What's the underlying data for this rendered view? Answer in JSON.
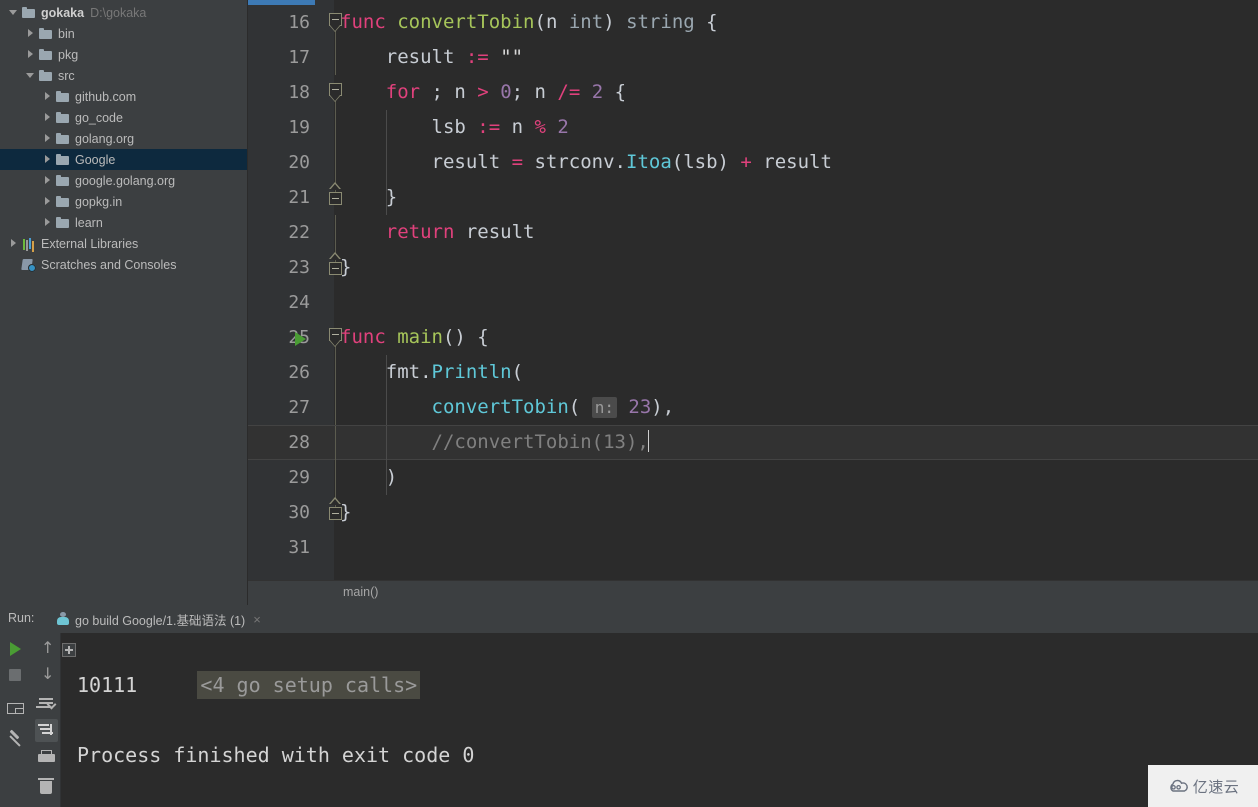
{
  "project_tree": {
    "items": [
      {
        "label": "gokaka",
        "sub": "D:\\gokaka",
        "icon": "folder-icon",
        "arrow": "open",
        "depth": 0,
        "bold": true,
        "selected": false
      },
      {
        "label": "bin",
        "sub": "",
        "icon": "folder-icon",
        "arrow": "closed",
        "depth": 1,
        "bold": false,
        "selected": false
      },
      {
        "label": "pkg",
        "sub": "",
        "icon": "folder-icon",
        "arrow": "closed",
        "depth": 1,
        "bold": false,
        "selected": false
      },
      {
        "label": "src",
        "sub": "",
        "icon": "folder-icon",
        "arrow": "open",
        "depth": 1,
        "bold": false,
        "selected": false
      },
      {
        "label": "github.com",
        "sub": "",
        "icon": "folder-icon",
        "arrow": "closed",
        "depth": 2,
        "bold": false,
        "selected": false
      },
      {
        "label": "go_code",
        "sub": "",
        "icon": "folder-icon",
        "arrow": "closed",
        "depth": 2,
        "bold": false,
        "selected": false
      },
      {
        "label": "golang.org",
        "sub": "",
        "icon": "folder-icon",
        "arrow": "closed",
        "depth": 2,
        "bold": false,
        "selected": false
      },
      {
        "label": "Google",
        "sub": "",
        "icon": "folder-icon",
        "arrow": "closed",
        "depth": 2,
        "bold": false,
        "selected": true
      },
      {
        "label": "google.golang.org",
        "sub": "",
        "icon": "folder-icon",
        "arrow": "closed",
        "depth": 2,
        "bold": false,
        "selected": false
      },
      {
        "label": "gopkg.in",
        "sub": "",
        "icon": "folder-icon",
        "arrow": "closed",
        "depth": 2,
        "bold": false,
        "selected": false
      },
      {
        "label": "learn",
        "sub": "",
        "icon": "folder-icon",
        "arrow": "closed",
        "depth": 2,
        "bold": false,
        "selected": false
      },
      {
        "label": "External Libraries",
        "sub": "",
        "icon": "external-libraries-icon",
        "arrow": "closed",
        "depth": 0,
        "bold": false,
        "selected": false
      },
      {
        "label": "Scratches and Consoles",
        "sub": "",
        "icon": "scratches-icon",
        "arrow": "none",
        "depth": 0,
        "bold": false,
        "selected": false
      }
    ]
  },
  "editor": {
    "first_visible_line": 16,
    "current_line": 28,
    "caret_line": 28,
    "breadcrumb": "main()",
    "lines": [
      {
        "no": "16",
        "fold": "start",
        "tokens": [
          {
            "t": "func",
            "c": "t-kw2"
          },
          {
            "t": " ",
            "c": "t-plain"
          },
          {
            "t": "convertTobin",
            "c": "t-fn"
          },
          {
            "t": "(",
            "c": "t-plain"
          },
          {
            "t": "n",
            "c": "t-plain"
          },
          {
            "t": " ",
            "c": "t-plain"
          },
          {
            "t": "int",
            "c": "t-type"
          },
          {
            "t": ") ",
            "c": "t-plain"
          },
          {
            "t": "string",
            "c": "t-type"
          },
          {
            "t": " {",
            "c": "t-plain"
          }
        ]
      },
      {
        "no": "17",
        "fold": "bar",
        "tokens": [
          {
            "t": "    result ",
            "c": "t-plain"
          },
          {
            "t": ":=",
            "c": "t-op"
          },
          {
            "t": " ",
            "c": "t-plain"
          },
          {
            "t": "\"\"",
            "c": "t-str"
          }
        ]
      },
      {
        "no": "18",
        "fold": "start2",
        "tokens": [
          {
            "t": "    ",
            "c": "t-plain"
          },
          {
            "t": "for",
            "c": "t-kw2"
          },
          {
            "t": " ; n ",
            "c": "t-plain"
          },
          {
            "t": ">",
            "c": "t-op"
          },
          {
            "t": " ",
            "c": "t-plain"
          },
          {
            "t": "0",
            "c": "t-num"
          },
          {
            "t": "; n ",
            "c": "t-plain"
          },
          {
            "t": "/=",
            "c": "t-op"
          },
          {
            "t": " ",
            "c": "t-plain"
          },
          {
            "t": "2",
            "c": "t-num"
          },
          {
            "t": " {",
            "c": "t-plain"
          }
        ]
      },
      {
        "no": "19",
        "fold": "bar2",
        "tokens": [
          {
            "t": "        lsb ",
            "c": "t-plain"
          },
          {
            "t": ":=",
            "c": "t-op"
          },
          {
            "t": " n ",
            "c": "t-plain"
          },
          {
            "t": "%",
            "c": "t-op"
          },
          {
            "t": " ",
            "c": "t-plain"
          },
          {
            "t": "2",
            "c": "t-num"
          }
        ]
      },
      {
        "no": "20",
        "fold": "bar2",
        "tokens": [
          {
            "t": "        result ",
            "c": "t-plain"
          },
          {
            "t": "=",
            "c": "t-op"
          },
          {
            "t": " strconv.",
            "c": "t-pkg"
          },
          {
            "t": "Itoa",
            "c": "t-method"
          },
          {
            "t": "(lsb) ",
            "c": "t-plain"
          },
          {
            "t": "+",
            "c": "t-op"
          },
          {
            "t": " result",
            "c": "t-plain"
          }
        ]
      },
      {
        "no": "21",
        "fold": "end2",
        "tokens": [
          {
            "t": "    }",
            "c": "t-plain"
          }
        ]
      },
      {
        "no": "22",
        "fold": "bar",
        "tokens": [
          {
            "t": "    ",
            "c": "t-plain"
          },
          {
            "t": "return",
            "c": "t-kw2"
          },
          {
            "t": " result",
            "c": "t-plain"
          }
        ]
      },
      {
        "no": "23",
        "fold": "end",
        "tokens": [
          {
            "t": "}",
            "c": "t-plain"
          }
        ]
      },
      {
        "no": "24",
        "fold": "none",
        "tokens": []
      },
      {
        "no": "25",
        "fold": "start",
        "runnable": true,
        "tokens": [
          {
            "t": "func",
            "c": "t-kw2"
          },
          {
            "t": " ",
            "c": "t-plain"
          },
          {
            "t": "main",
            "c": "t-fn"
          },
          {
            "t": "() {",
            "c": "t-plain"
          }
        ]
      },
      {
        "no": "26",
        "fold": "bar",
        "tokens": [
          {
            "t": "    fmt.",
            "c": "t-pkg"
          },
          {
            "t": "Println",
            "c": "t-method"
          },
          {
            "t": "(",
            "c": "t-plain"
          }
        ]
      },
      {
        "no": "27",
        "fold": "bar",
        "tokens": [
          {
            "t": "        ",
            "c": "t-plain"
          },
          {
            "t": "convertTobin",
            "c": "t-method"
          },
          {
            "t": "( ",
            "c": "t-plain"
          },
          {
            "t": "n:",
            "c": "param-hint"
          },
          {
            "t": " ",
            "c": "t-plain"
          },
          {
            "t": "23",
            "c": "t-num"
          },
          {
            "t": "),",
            "c": "t-plain"
          }
        ]
      },
      {
        "no": "28",
        "fold": "bar",
        "current": true,
        "caret": true,
        "tokens": [
          {
            "t": "        //convertTobin(13),",
            "c": "t-comment"
          }
        ]
      },
      {
        "no": "29",
        "fold": "bar",
        "tokens": [
          {
            "t": "    )",
            "c": "t-plain"
          }
        ]
      },
      {
        "no": "30",
        "fold": "end",
        "tokens": [
          {
            "t": "}",
            "c": "t-plain"
          }
        ]
      },
      {
        "no": "31",
        "fold": "none",
        "tokens": []
      }
    ]
  },
  "run_panel": {
    "label": "Run:",
    "tab_title": "go build Google/1.基础语法 (1)",
    "tab_close": "×",
    "toolbar_left": [
      {
        "name": "rerun-button",
        "icon": "run-icon"
      },
      {
        "name": "stop-button",
        "icon": "stop-icon"
      },
      {
        "name": "layout-button",
        "icon": "layout-icon"
      },
      {
        "name": "pin-tab-button",
        "icon": "pin-icon"
      }
    ],
    "toolbar_right": [
      {
        "name": "up-button",
        "icon": "arrow-up-icon"
      },
      {
        "name": "down-button",
        "icon": "arrow-down-icon"
      },
      {
        "name": "soft-wrap-button",
        "icon": "soft-wrap-icon"
      },
      {
        "name": "scroll-to-end-button",
        "icon": "scroll-to-end-icon",
        "active": true
      },
      {
        "name": "print-button",
        "icon": "print-icon"
      },
      {
        "name": "clear-all-button",
        "icon": "trash-icon"
      }
    ],
    "console": {
      "folded_line": "<4 go setup calls>",
      "output": "10111",
      "blank": "",
      "finished": "Process finished with exit code 0"
    }
  },
  "watermark": {
    "text": "亿速云",
    "icon": "cloud-icon"
  },
  "colors": {
    "selection": "#0d293e",
    "accent_blue": "#3d7ab5",
    "run_green": "#4a9c34",
    "keyword": "#e0417c",
    "number": "#9876aa",
    "method": "#5fc8d8",
    "function": "#a6c55a",
    "comment": "#808080"
  }
}
